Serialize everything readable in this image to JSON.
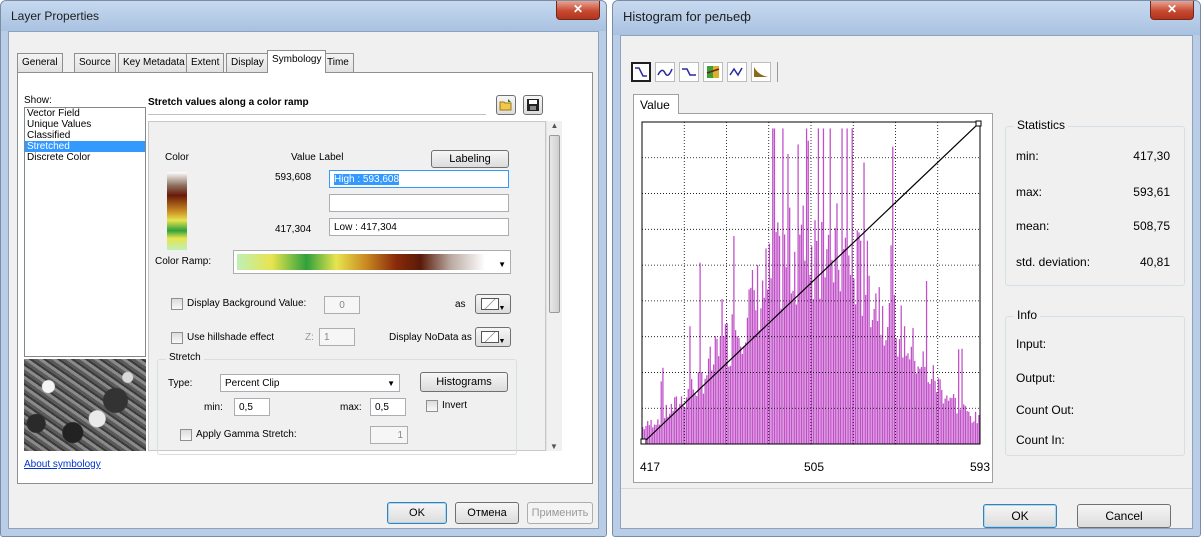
{
  "layer_properties": {
    "title": "Layer Properties",
    "close_glyph": "✕",
    "tabs": [
      "General",
      "Source",
      "Key Metadata",
      "Extent",
      "Display",
      "Symbology",
      "Time"
    ],
    "active_tab": "Symbology",
    "show_label": "Show:",
    "show_items": [
      "Vector Field",
      "Unique Values",
      "Classified",
      "Stretched",
      "Discrete Color"
    ],
    "selected_item": "Stretched",
    "about_link": "About symbology",
    "heading": "Stretch values along a color ramp",
    "color_header": "Color",
    "value_header": "Value",
    "label_header": "Label",
    "labeling_button": "Labeling",
    "high_value": "593,608",
    "high_label": "High : 593,608",
    "low_value": "417,304",
    "low_label": "Low : 417,304",
    "color_ramp_label": "Color Ramp:",
    "display_background_label": "Display Background Value:",
    "background_value": "0",
    "as_label": "as",
    "hillshade_label": "Use hillshade effect",
    "z_label": "Z:",
    "z_value": "1",
    "nodata_label": "Display NoData as",
    "stretch_group": "Stretch",
    "type_label": "Type:",
    "type_value": "Percent Clip",
    "histograms_button": "Histograms",
    "min_label": "min:",
    "min_value": "0,5",
    "max_label": "max:",
    "max_value": "0,5",
    "invert_label": "Invert",
    "gamma_label": "Apply Gamma Stretch:",
    "gamma_value": "1",
    "ok_button": "OK",
    "cancel_button": "Отмена",
    "apply_button": "Применить",
    "colors": {
      "selection": "#3399ff",
      "link": "#0033cc",
      "ramp": [
        "#bdf0b6",
        "#e8e44e",
        "#2fa13c",
        "#e8e44e",
        "#c98a22",
        "#8a2a0a",
        "#5a1a08",
        "#ffffff"
      ]
    }
  },
  "histogram": {
    "title": "Histogram for рельеф",
    "close_glyph": "✕",
    "tool_icons": [
      "curve-line-icon",
      "curve-wave-icon",
      "curve-dip-icon",
      "curve-color-icon",
      "curve-peak-icon",
      "curve-exp-icon"
    ],
    "tab_label": "Value",
    "axis_labels": [
      "417",
      "505",
      "593"
    ],
    "statistics_title": "Statistics",
    "stats": [
      {
        "label": "min:",
        "value": "417,30"
      },
      {
        "label": "max:",
        "value": "593,61"
      },
      {
        "label": "mean:",
        "value": "508,75"
      },
      {
        "label": "std. deviation:",
        "value": "40,81"
      }
    ],
    "info_title": "Info",
    "info": [
      "Input:",
      "Output:",
      "Count Out:",
      "Count In:"
    ],
    "ok_button": "OK",
    "cancel_button": "Cancel",
    "colors": {
      "bars": "#c04fc8",
      "grid": "#000000",
      "line": "#000000"
    }
  },
  "chart_data": {
    "type": "bar",
    "xlim": [
      417.3,
      593.61
    ],
    "min": 417.3,
    "max": 593.61,
    "mean": 508.75,
    "std": 40.81,
    "tick_labels": [
      "417",
      "505",
      "593"
    ],
    "grid": true,
    "bins": 200
  }
}
